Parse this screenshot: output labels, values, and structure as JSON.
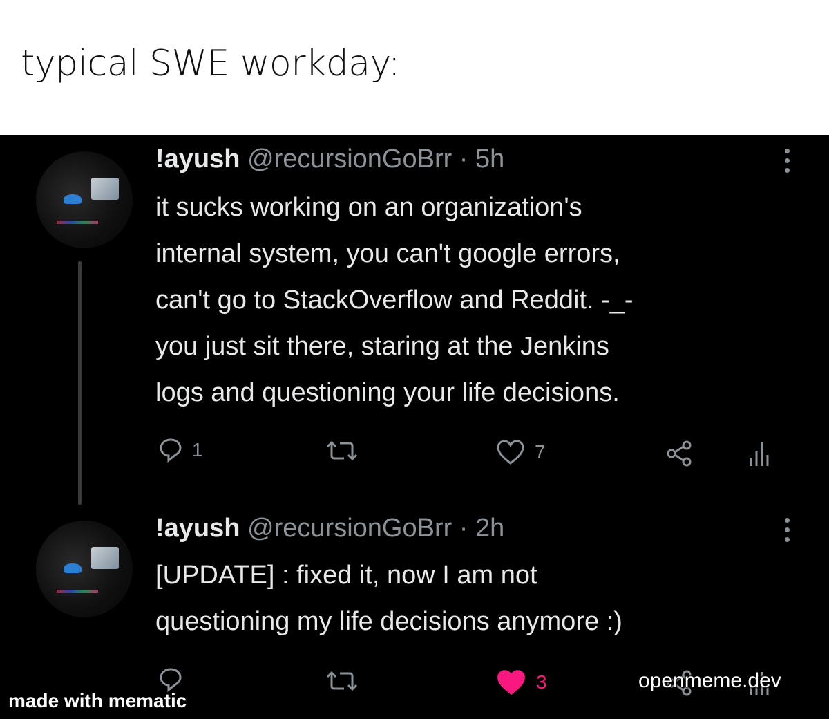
{
  "caption": {
    "text": "typical SWE workday:"
  },
  "tweets": [
    {
      "name": "!ayush",
      "handle_time": "@recursionGoBrr · 5h",
      "lines": [
        "it sucks working on an organization's",
        "internal system, you can't google errors,",
        "can't go to StackOverflow and Reddit. -_-",
        "you just sit there, staring at the Jenkins",
        "logs and questioning your life decisions."
      ],
      "replies": "1",
      "likes": "7",
      "liked": false
    },
    {
      "name": "!ayush",
      "handle_time": "@recursionGoBrr · 2h",
      "lines": [
        "[UPDATE] : fixed it, now I am not",
        "questioning my life decisions anymore :)"
      ],
      "replies": "",
      "likes": "3",
      "liked": true
    }
  ],
  "colors": {
    "like_active": "#f91880",
    "muted": "#8b9298",
    "text": "#e7e9ea"
  },
  "watermarks": {
    "left": "made with mematic",
    "right": "openmeme.dev"
  }
}
